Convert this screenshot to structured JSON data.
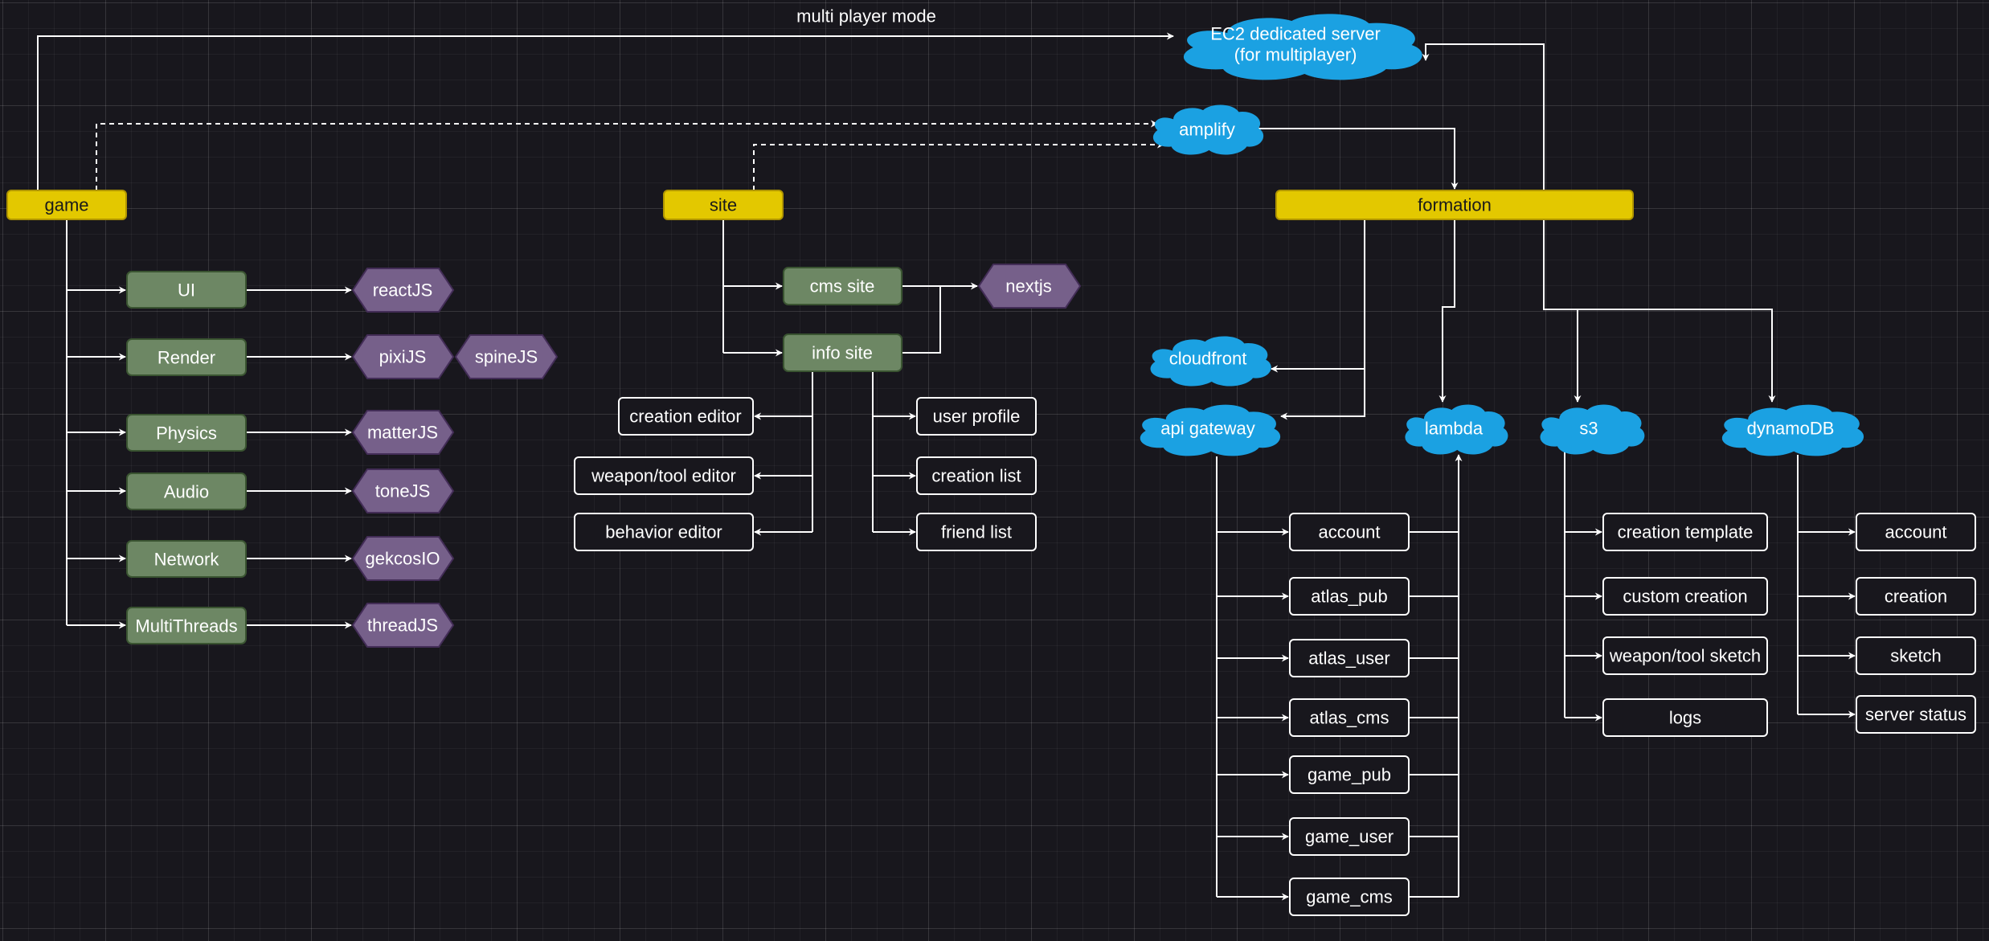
{
  "colors": {
    "background": "#18171d",
    "root": "#e3c800",
    "root_stroke": "#b09500",
    "module": "#6d8764",
    "module_stroke": "#3a5431",
    "lib": "#76608a",
    "lib_stroke": "#432d57",
    "cloud": "#1ba1e2",
    "line": "#ffffff"
  },
  "edge_labels": {
    "multiplayer": "multi player mode"
  },
  "roots": {
    "game": "game",
    "site": "site",
    "formation": "formation"
  },
  "clouds": {
    "ec2": [
      "EC2 dedicated server",
      "(for multiplayer)"
    ],
    "amplify": "amplify",
    "cloudfront": "cloudfront",
    "api_gateway": "api gateway",
    "lambda": "lambda",
    "s3": "s3",
    "dynamodb": "dynamoDB"
  },
  "game_modules": [
    {
      "label": "UI",
      "libs": [
        "reactJS"
      ]
    },
    {
      "label": "Render",
      "libs": [
        "pixiJS",
        "spineJS"
      ]
    },
    {
      "label": "Physics",
      "libs": [
        "matterJS"
      ]
    },
    {
      "label": "Audio",
      "libs": [
        "toneJS"
      ]
    },
    {
      "label": "Network",
      "libs": [
        "gekcosIO"
      ]
    },
    {
      "label": "MultiThreads",
      "libs": [
        "threadJS"
      ]
    }
  ],
  "site_modules": {
    "cms_site": "cms site",
    "info_site": "info site",
    "framework": "nextjs"
  },
  "site_pages_left": [
    "creation editor",
    "weapon/tool editor",
    "behavior editor"
  ],
  "site_pages_right": [
    "user profile",
    "creation list",
    "friend list"
  ],
  "api_endpoints": [
    "account",
    "atlas_pub",
    "atlas_user",
    "atlas_cms",
    "game_pub",
    "game_user",
    "game_cms"
  ],
  "s3_items": [
    "creation template",
    "custom creation",
    "weapon/tool sketch",
    "logs"
  ],
  "dynamo_tables": [
    "account",
    "creation",
    "sketch",
    "server status"
  ]
}
